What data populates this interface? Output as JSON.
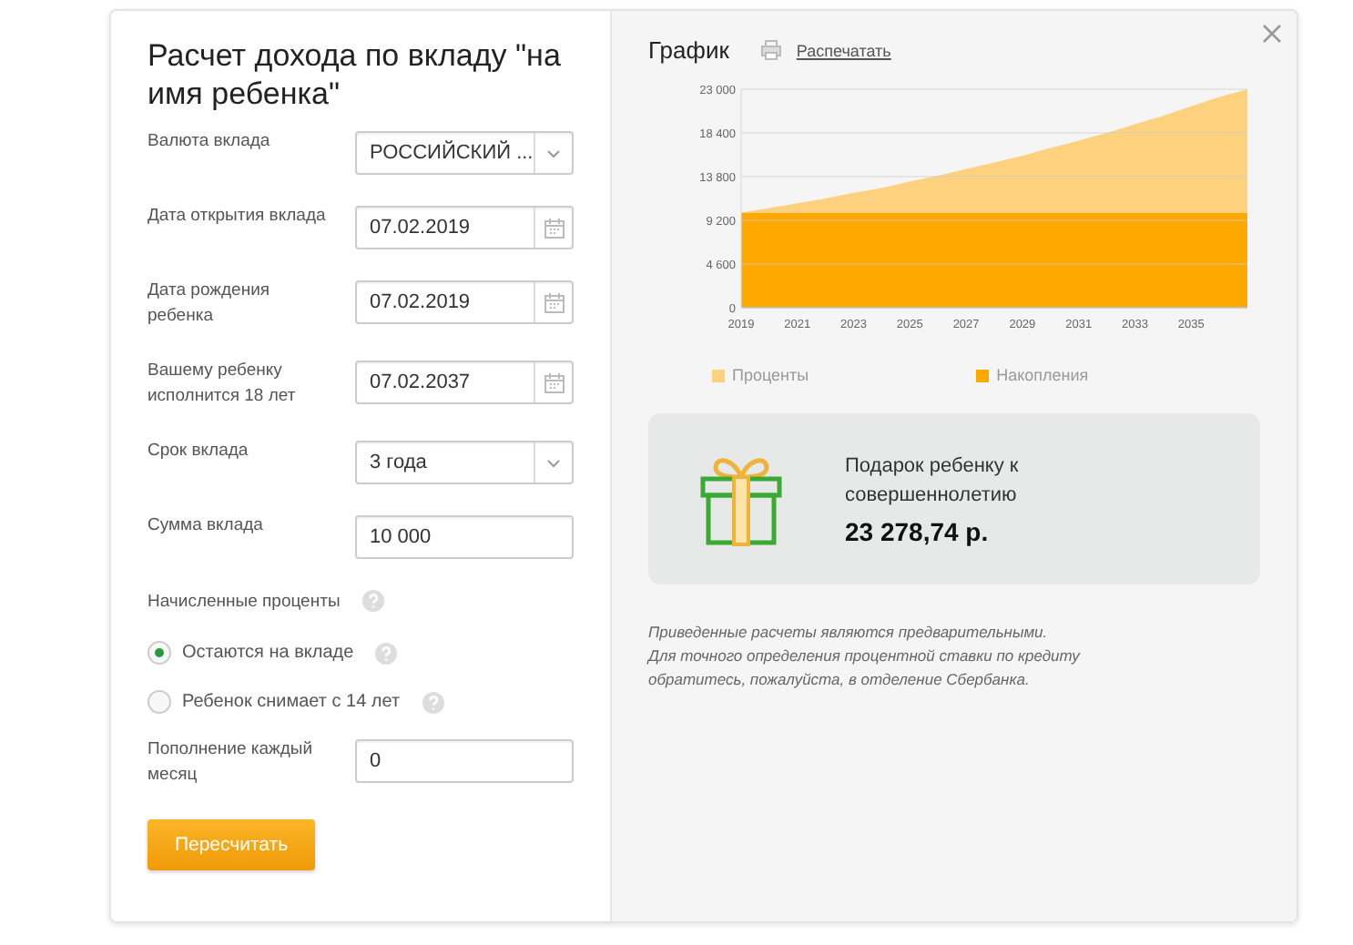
{
  "title": "Расчет дохода по вкладу \"на имя ребенка\"",
  "fields": [
    {
      "label": "Валюта вклада",
      "kind": "select",
      "value": "РОССИЙСКИЙ ..."
    },
    {
      "label": "Дата открытия вклада",
      "kind": "date",
      "value": "07.02.2019"
    },
    {
      "label": "Дата рождения ребенка",
      "kind": "date",
      "value": "07.02.2019"
    },
    {
      "label": "Вашему ребенку исполнится 18 лет",
      "kind": "date",
      "value": "07.02.2037"
    },
    {
      "label": "Срок вклада",
      "kind": "select",
      "value": "3 года"
    },
    {
      "label": "Сумма вклада",
      "kind": "text",
      "value": "10 000"
    }
  ],
  "accrued": {
    "label": "Начисленные проценты",
    "options": [
      {
        "label": "Остаются на вкладе",
        "selected": true
      },
      {
        "label": "Ребенок снимает с 14 лет",
        "selected": false
      }
    ]
  },
  "monthly": {
    "label": "Пополнение каждый месяц",
    "value": "0"
  },
  "button": "Пересчитать",
  "chart_panel": {
    "title": "График",
    "print_link": "Распечатать",
    "chart_data": {
      "type": "area",
      "stacked": true,
      "x": [
        2019,
        2020,
        2021,
        2022,
        2023,
        2024,
        2025,
        2026,
        2027,
        2028,
        2029,
        2030,
        2031,
        2032,
        2033,
        2034,
        2035,
        2036,
        2037
      ],
      "xlim": [
        2019,
        2037
      ],
      "ylim": [
        0,
        23000
      ],
      "grid": true,
      "legend": true,
      "xticks": [
        2019,
        2021,
        2023,
        2025,
        2027,
        2029,
        2031,
        2033,
        2035
      ],
      "yticks": [
        {
          "value": 0,
          "label": "0"
        },
        {
          "value": 4600,
          "label": "4 600"
        },
        {
          "value": 9200,
          "label": "9 200"
        },
        {
          "value": 13800,
          "label": "13 800"
        },
        {
          "value": 18400,
          "label": "18 400"
        },
        {
          "value": 23000,
          "label": "23 000"
        }
      ],
      "series": [
        {
          "name": "Проценты",
          "color": "#fdd17e",
          "values": [
            0,
            500,
            1000,
            1500,
            2100,
            2600,
            3300,
            3900,
            4600,
            5300,
            6000,
            6800,
            7600,
            8400,
            9300,
            10200,
            11200,
            12200,
            13000
          ]
        },
        {
          "name": "Накопления",
          "color": "#ffa800",
          "values": [
            10000,
            10000,
            10000,
            10000,
            10000,
            10000,
            10000,
            10000,
            10000,
            10000,
            10000,
            10000,
            10000,
            10000,
            10000,
            10000,
            10000,
            10000,
            10000
          ]
        }
      ]
    }
  },
  "gift": {
    "text": "Подарок ребенку к совершеннолетию",
    "amount": "23 278,74 р."
  },
  "disclaimer": "Приведенные расчеты являются предварительными.\nДля точного определения процентной ставки по кредиту\nобратитесь, пожалуйста, в отделение Сбербанка."
}
